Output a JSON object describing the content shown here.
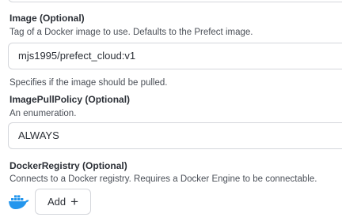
{
  "image_field": {
    "label": "Image (Optional)",
    "description": "Tag of a Docker image to use. Defaults to the Prefect image.",
    "value": "mjs1995/prefect_cloud:v1"
  },
  "pull_description": "Specifies if the image should be pulled.",
  "image_pull_policy": {
    "label": "ImagePullPolicy (Optional)",
    "description": "An enumeration.",
    "value": "ALWAYS"
  },
  "docker_registry": {
    "label": "DockerRegistry (Optional)",
    "description": "Connects to a Docker registry. Requires a Docker Engine to be connectable.",
    "icon": "docker-icon",
    "add_label": "Add",
    "add_icon": "+"
  },
  "colors": {
    "docker_blue": "#2496ed",
    "border": "#d4d6db"
  }
}
